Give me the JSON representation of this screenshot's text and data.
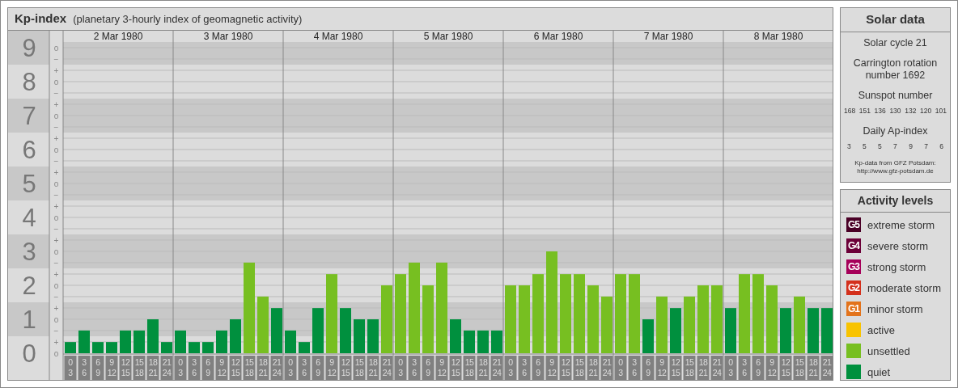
{
  "kp_panel": {
    "title": "Kp-index",
    "subtitle": "(planetary 3-hourly index of geomagnetic activity)",
    "dates": [
      "2 Mar 1980",
      "3 Mar 1980",
      "4 Mar 1980",
      "5 Mar 1980",
      "6 Mar 1980",
      "7 Mar 1980",
      "8 Mar 1980"
    ],
    "minor_scale": [
      "o",
      "−",
      "+",
      "o",
      "−",
      "+",
      "o",
      "−",
      "+",
      "o",
      "−",
      "+",
      "o",
      "−",
      "+",
      "o",
      "−",
      "+",
      "o",
      "−",
      "+",
      "o",
      "−",
      "+",
      "o",
      "−",
      "+",
      "o"
    ],
    "chart_data": {
      "type": "bar",
      "grid": true,
      "categories": [
        "0\n3",
        "3\n6",
        "6\n9",
        "9\n12",
        "12\n15",
        "15\n18",
        "18\n21",
        "21\n24",
        "0\n3",
        "3\n6",
        "6\n9",
        "9\n12",
        "12\n15",
        "15\n18",
        "18\n21",
        "21\n24",
        "0\n3",
        "3\n6",
        "6\n9",
        "9\n12",
        "12\n15",
        "15\n18",
        "18\n21",
        "21\n24",
        "0\n3",
        "3\n6",
        "6\n9",
        "9\n12",
        "12\n15",
        "15\n18",
        "18\n21",
        "21\n24",
        "0\n3",
        "3\n6",
        "6\n9",
        "9\n12",
        "12\n15",
        "15\n18",
        "18\n21",
        "21\n24",
        "0\n3",
        "3\n6",
        "6\n9",
        "9\n12",
        "12\n15",
        "15\n18",
        "18\n21",
        "21\n24",
        "0\n3",
        "3\n6",
        "6\n9",
        "9\n12",
        "12\n15",
        "15\n18",
        "18\n21",
        "21\n24"
      ],
      "series": [
        {
          "color": "#00903e",
          "values": [
            0.33,
            0.67,
            0.33,
            0.33,
            0.67,
            0.67,
            1,
            0.33,
            0.67,
            0.33,
            0.33,
            0.67,
            1,
            null,
            null,
            1.33,
            0.67,
            0.33,
            1.33,
            null,
            1.33,
            1,
            1,
            null,
            null,
            null,
            null,
            null,
            1,
            0.67,
            0.67,
            0.67,
            null,
            null,
            null,
            null,
            null,
            null,
            null,
            null,
            null,
            null,
            1,
            null,
            1.33,
            null,
            null,
            null,
            1.33,
            null,
            null,
            null,
            1.33,
            null,
            1.33,
            1.33
          ]
        },
        {
          "color": "#77bf21",
          "values": [
            null,
            null,
            null,
            null,
            null,
            null,
            null,
            null,
            null,
            null,
            null,
            null,
            null,
            2.67,
            1.67,
            null,
            null,
            null,
            null,
            2.33,
            null,
            null,
            null,
            2,
            2.33,
            2.67,
            2,
            2.67,
            null,
            null,
            null,
            null,
            2,
            2,
            2.33,
            3,
            2.33,
            2.33,
            2,
            1.67,
            2.33,
            2.33,
            null,
            1.67,
            null,
            1.67,
            2,
            2,
            null,
            2.33,
            2.33,
            2,
            null,
            1.67,
            null,
            null
          ]
        }
      ],
      "ylim": [
        0,
        9
      ],
      "yticks": [
        {
          "value": 9,
          "label": "9"
        },
        {
          "value": 8,
          "label": "8"
        },
        {
          "value": 7,
          "label": "7"
        },
        {
          "value": 6,
          "label": "6"
        },
        {
          "value": 5,
          "label": "5"
        },
        {
          "value": 4,
          "label": "4"
        },
        {
          "value": 3,
          "label": "3"
        },
        {
          "value": 2,
          "label": "2"
        },
        {
          "value": 1,
          "label": "1"
        },
        {
          "value": 0,
          "label": "0"
        }
      ]
    }
  },
  "solar_data": {
    "title": "Solar data",
    "cycle": "Solar cycle 21",
    "rotation": "Carrington rotation number 1692",
    "sunspot_label": "Sunspot number",
    "sunspot_numbers": [
      "168",
      "151",
      "136",
      "130",
      "132",
      "120",
      "101"
    ],
    "ap_label": "Daily Ap-index",
    "ap_values": [
      "3",
      "5",
      "5",
      "7",
      "9",
      "7",
      "6"
    ],
    "source": "Kp-data from GFZ Potsdam:",
    "source_url": "http://www.gfz-potsdam.de"
  },
  "activity_levels": {
    "title": "Activity levels",
    "items": [
      {
        "badge": "G5",
        "label": "extreme storm",
        "color": "#4a0026"
      },
      {
        "badge": "G4",
        "label": "severe storm",
        "color": "#6c0038"
      },
      {
        "badge": "G3",
        "label": "strong storm",
        "color": "#a6005a"
      },
      {
        "badge": "G2",
        "label": "moderate storm",
        "color": "#d4301c"
      },
      {
        "badge": "G1",
        "label": "minor storm",
        "color": "#e3731b"
      },
      {
        "label": "active",
        "color": "#f8c300"
      },
      {
        "label": "unsettled",
        "color": "#77bf21"
      },
      {
        "label": "quiet",
        "color": "#00903e"
      }
    ]
  }
}
